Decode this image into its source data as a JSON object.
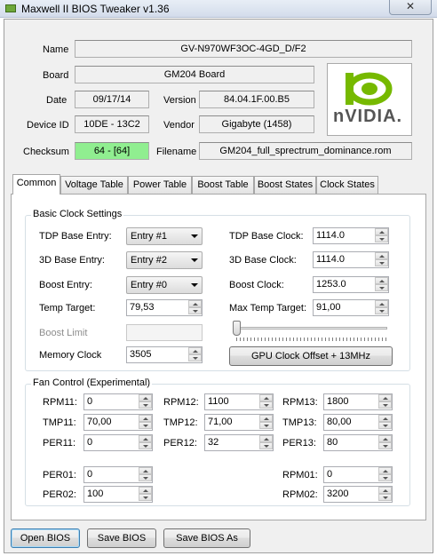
{
  "window": {
    "title": "Maxwell II BIOS Tweaker v1.36",
    "close_glyph": "✕"
  },
  "info": {
    "name_label": "Name",
    "name_value": "GV-N970WF3OC-4GD_D/F2",
    "board_label": "Board",
    "board_value": "GM204 Board",
    "date_label": "Date",
    "date_value": "09/17/14",
    "version_label": "Version",
    "version_value": "84.04.1F.00.B5",
    "device_id_label": "Device ID",
    "device_id_value": "10DE - 13C2",
    "vendor_label": "Vendor",
    "vendor_value": "Gigabyte (1458)",
    "checksum_label": "Checksum",
    "checksum_value": "64 - [64]",
    "filename_label": "Filename",
    "filename_value": "GM204_full_sprectrum_dominance.rom",
    "logo_text": "nVIDIA."
  },
  "tabs": [
    {
      "label": "Common"
    },
    {
      "label": "Voltage Table"
    },
    {
      "label": "Power Table"
    },
    {
      "label": "Boost Table"
    },
    {
      "label": "Boost States"
    },
    {
      "label": "Clock States"
    }
  ],
  "basic_clock": {
    "title": "Basic Clock Settings",
    "tdp_base_entry_label": "TDP Base Entry:",
    "tdp_base_entry_value": "Entry #1",
    "base_3d_entry_label": "3D Base Entry:",
    "base_3d_entry_value": "Entry #2",
    "boost_entry_label": "Boost Entry:",
    "boost_entry_value": "Entry #0",
    "temp_target_label": "Temp Target:",
    "temp_target_value": "79,53",
    "boost_limit_label": "Boost Limit",
    "boost_limit_value": "",
    "memory_clock_label": "Memory Clock",
    "memory_clock_value": "3505",
    "tdp_base_clock_label": "TDP Base Clock:",
    "tdp_base_clock_value": "1114.0",
    "base_3d_clock_label": "3D Base Clock:",
    "base_3d_clock_value": "1114.0",
    "boost_clock_label": "Boost Clock:",
    "boost_clock_value": "1253.0",
    "max_temp_target_label": "Max Temp Target:",
    "max_temp_target_value": "91,00",
    "gpu_clock_offset_button": "GPU Clock Offset + 13MHz"
  },
  "fan_control": {
    "title": "Fan Control (Experimental)",
    "rpm11_label": "RPM11:",
    "rpm11_value": "0",
    "tmp11_label": "TMP11:",
    "tmp11_value": "70,00",
    "per11_label": "PER11:",
    "per11_value": "0",
    "rpm12_label": "RPM12:",
    "rpm12_value": "1100",
    "tmp12_label": "TMP12:",
    "tmp12_value": "71,00",
    "per12_label": "PER12:",
    "per12_value": "32",
    "rpm13_label": "RPM13:",
    "rpm13_value": "1800",
    "tmp13_label": "TMP13:",
    "tmp13_value": "80,00",
    "per13_label": "PER13:",
    "per13_value": "80",
    "per01_label": "PER01:",
    "per01_value": "0",
    "per02_label": "PER02:",
    "per02_value": "100",
    "rpm01_label": "RPM01:",
    "rpm01_value": "0",
    "rpm02_label": "RPM02:",
    "rpm02_value": "3200"
  },
  "footer": {
    "open_bios": "Open BIOS",
    "save_bios": "Save BIOS",
    "save_bios_as": "Save BIOS As"
  },
  "colors": {
    "checksum_ok": "#90ee90",
    "nvidia_green": "#76b900"
  }
}
